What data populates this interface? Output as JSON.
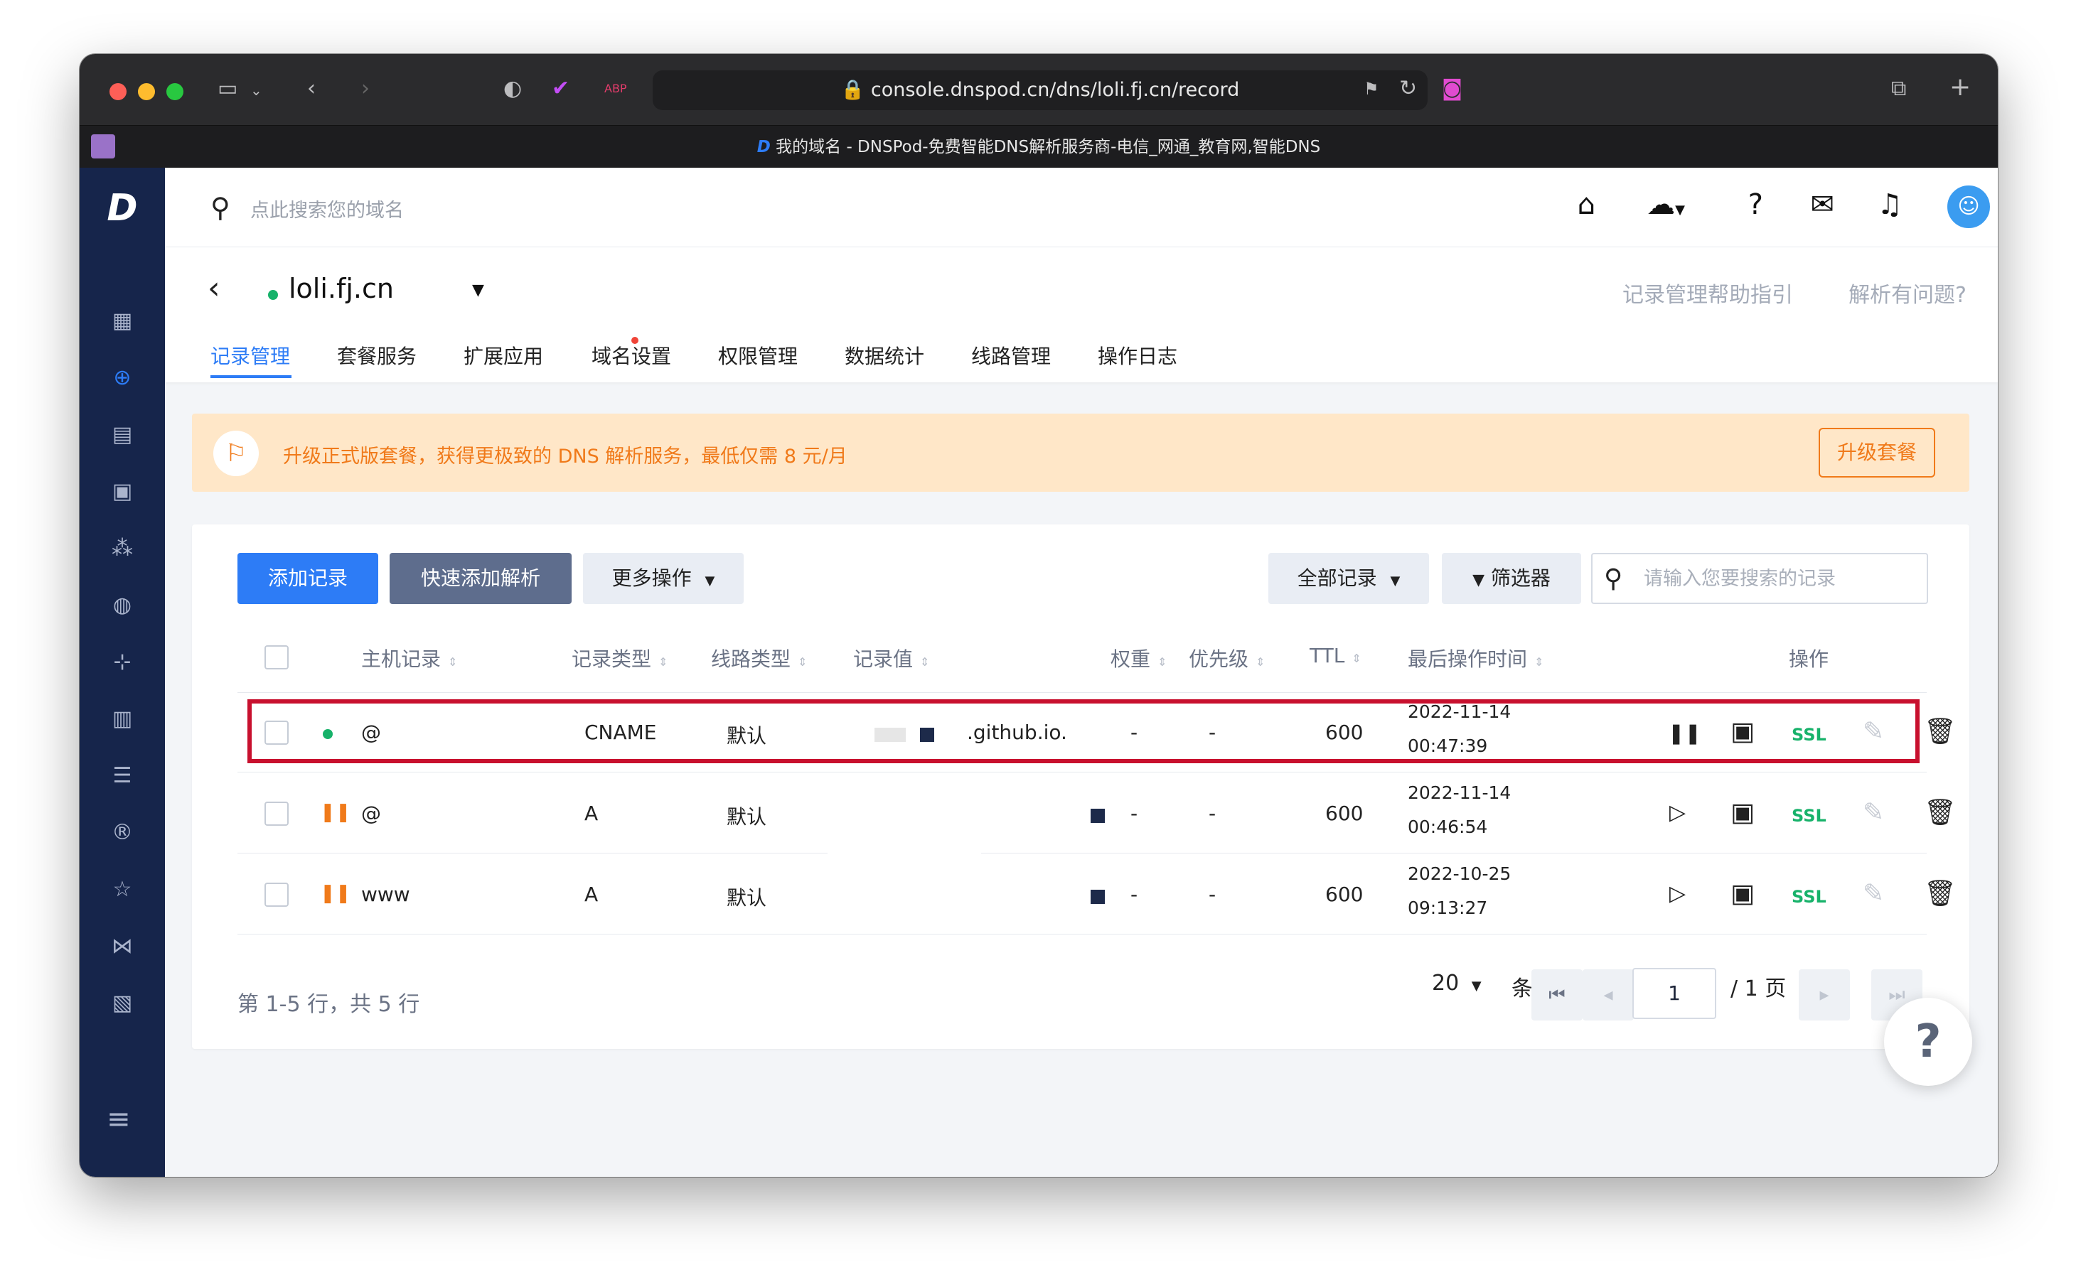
{
  "browser": {
    "url": "console.dnspod.cn/dns/loli.fj.cn/record",
    "tab_title": "我的域名 - DNSPod-免费智能DNS解析服务商-电信_网通_教育网,智能DNS",
    "logo_letter": "D"
  },
  "topbar": {
    "search_placeholder": "点此搜索您的域名"
  },
  "header": {
    "domain": "loli.fj.cn",
    "help_links": [
      "记录管理帮助指引",
      "解析有问题?"
    ],
    "tabs": [
      "记录管理",
      "套餐服务",
      "扩展应用",
      "域名设置",
      "权限管理",
      "数据统计",
      "线路管理",
      "操作日志"
    ],
    "active_tab": 0
  },
  "banner": {
    "text": "升级正式版套餐，获得更极致的 DNS 解析服务，最低仅需 8 元/月",
    "button": "升级套餐"
  },
  "toolbar": {
    "add_record": "添加记录",
    "quick_add": "快速添加解析",
    "more_actions": "更多操作",
    "all_records": "全部记录",
    "filter": "筛选器",
    "search_placeholder": "请输入您要搜索的记录"
  },
  "table": {
    "headers": {
      "host": "主机记录",
      "type": "记录类型",
      "line": "线路类型",
      "value": "记录值",
      "weight": "权重",
      "priority": "优先级",
      "ttl": "TTL",
      "time": "最后操作时间",
      "actions": "操作"
    },
    "rows": [
      {
        "status": "enabled",
        "host": "@",
        "type": "CNAME",
        "line": "默认",
        "value": ".github.io.",
        "weight": "-",
        "priority": "-",
        "ttl": "600",
        "date": "2022-11-14",
        "time": "00:47:39",
        "ssl": "SSL"
      },
      {
        "status": "paused",
        "host": "@",
        "type": "A",
        "line": "默认",
        "value": "",
        "weight": "-",
        "priority": "-",
        "ttl": "600",
        "date": "2022-11-14",
        "time": "00:46:54",
        "ssl": "SSL"
      },
      {
        "status": "paused",
        "host": "www",
        "type": "A",
        "line": "默认",
        "value": "",
        "weight": "-",
        "priority": "-",
        "ttl": "600",
        "date": "2022-10-25",
        "time": "09:13:27",
        "ssl": "SSL"
      }
    ]
  },
  "footer": {
    "summary": "第 1-5 行，共 5 行",
    "page_size": "20",
    "per_page_label": "条 / 页",
    "current_page": "1",
    "total_pages_label": "/ 1 页"
  },
  "colors": {
    "primary": "#2d7cf6",
    "sidebar": "#16254b",
    "warning": "#f07a1a",
    "success": "#17b26a",
    "highlight_border": "#c8102e"
  }
}
